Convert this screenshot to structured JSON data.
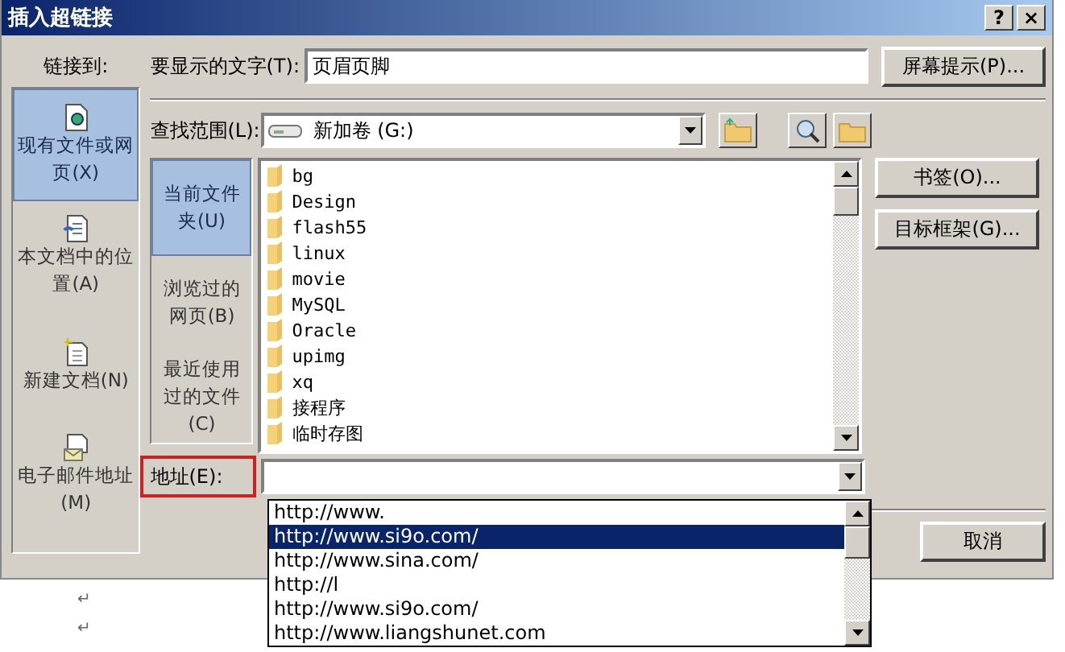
{
  "window": {
    "title": "插入超链接",
    "help": "?",
    "close": "×"
  },
  "link_to": {
    "label": "链接到:",
    "items": [
      {
        "label": "现有文件或网页(X)",
        "kind": "file",
        "selected": true
      },
      {
        "label": "本文档中的位置(A)",
        "kind": "place",
        "selected": false
      },
      {
        "label": "新建文档(N)",
        "kind": "new",
        "selected": false
      },
      {
        "label": "电子邮件地址(M)",
        "kind": "email",
        "selected": false
      }
    ]
  },
  "display_text": {
    "label": "要显示的文字(T):",
    "value": "页眉页脚"
  },
  "screen_tip_button": "屏幕提示(P)...",
  "look_in": {
    "label": "查找范围(L):",
    "value": "新加卷 (G:)"
  },
  "browse_nav": [
    {
      "label": "当前文件夹(U)",
      "selected": true
    },
    {
      "label": "浏览过的网页(B)",
      "selected": false
    },
    {
      "label": "最近使用过的文件(C)",
      "selected": false
    }
  ],
  "files": [
    "bg",
    "Design",
    "flash55",
    "linux",
    "movie",
    "MySQL",
    "Oracle",
    "upimg",
    "xq",
    "接程序",
    "临时存图"
  ],
  "side_buttons": [
    "书签(O)...",
    "目标框架(G)..."
  ],
  "address": {
    "label": "地址(E):",
    "highlighted": true
  },
  "address_suggestions": [
    {
      "text": "http://www.",
      "selected": false
    },
    {
      "text": "http://www.si9o.com/",
      "selected": true
    },
    {
      "text": "http://www.sina.com/",
      "selected": false
    },
    {
      "text": "http://l",
      "selected": false
    },
    {
      "text": "http://www.si9o.com/",
      "selected": false
    },
    {
      "text": "http://www.liangshunet.com",
      "selected": false
    }
  ],
  "cancel_button": "取消",
  "document": {
    "paragraph_marks": [
      "↵",
      "↵"
    ]
  }
}
